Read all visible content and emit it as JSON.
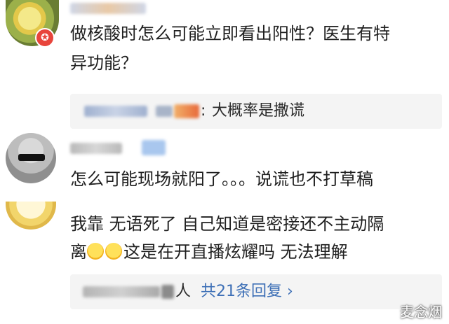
{
  "comments": [
    {
      "text_line1": "做核酸时怎么可能立即看出阳性？医生有特",
      "text_line2": "异功能？",
      "reply": {
        "separator": ":",
        "text": "大概率是撒谎"
      }
    },
    {
      "text_line1": "怎么可能现场就阳了。。。说谎也不打草稿"
    },
    {
      "text_line1": "我靠 无语死了 自己知道是密接还不主动隔",
      "text_line2": "这是在开直播炫耀吗 无法理解",
      "text_line2_prefix": "离",
      "replies_suffix": "人",
      "more_replies": "共21条回复 ›"
    }
  ],
  "watermark": "麦念烟",
  "colors": {
    "link": "#3d6fb6",
    "reply_bg": "#f4f4f4",
    "text": "#1f1f1f"
  },
  "icons": [
    "avatar-lemon",
    "avatar-anime",
    "avatar-duck",
    "smile-emoji"
  ]
}
